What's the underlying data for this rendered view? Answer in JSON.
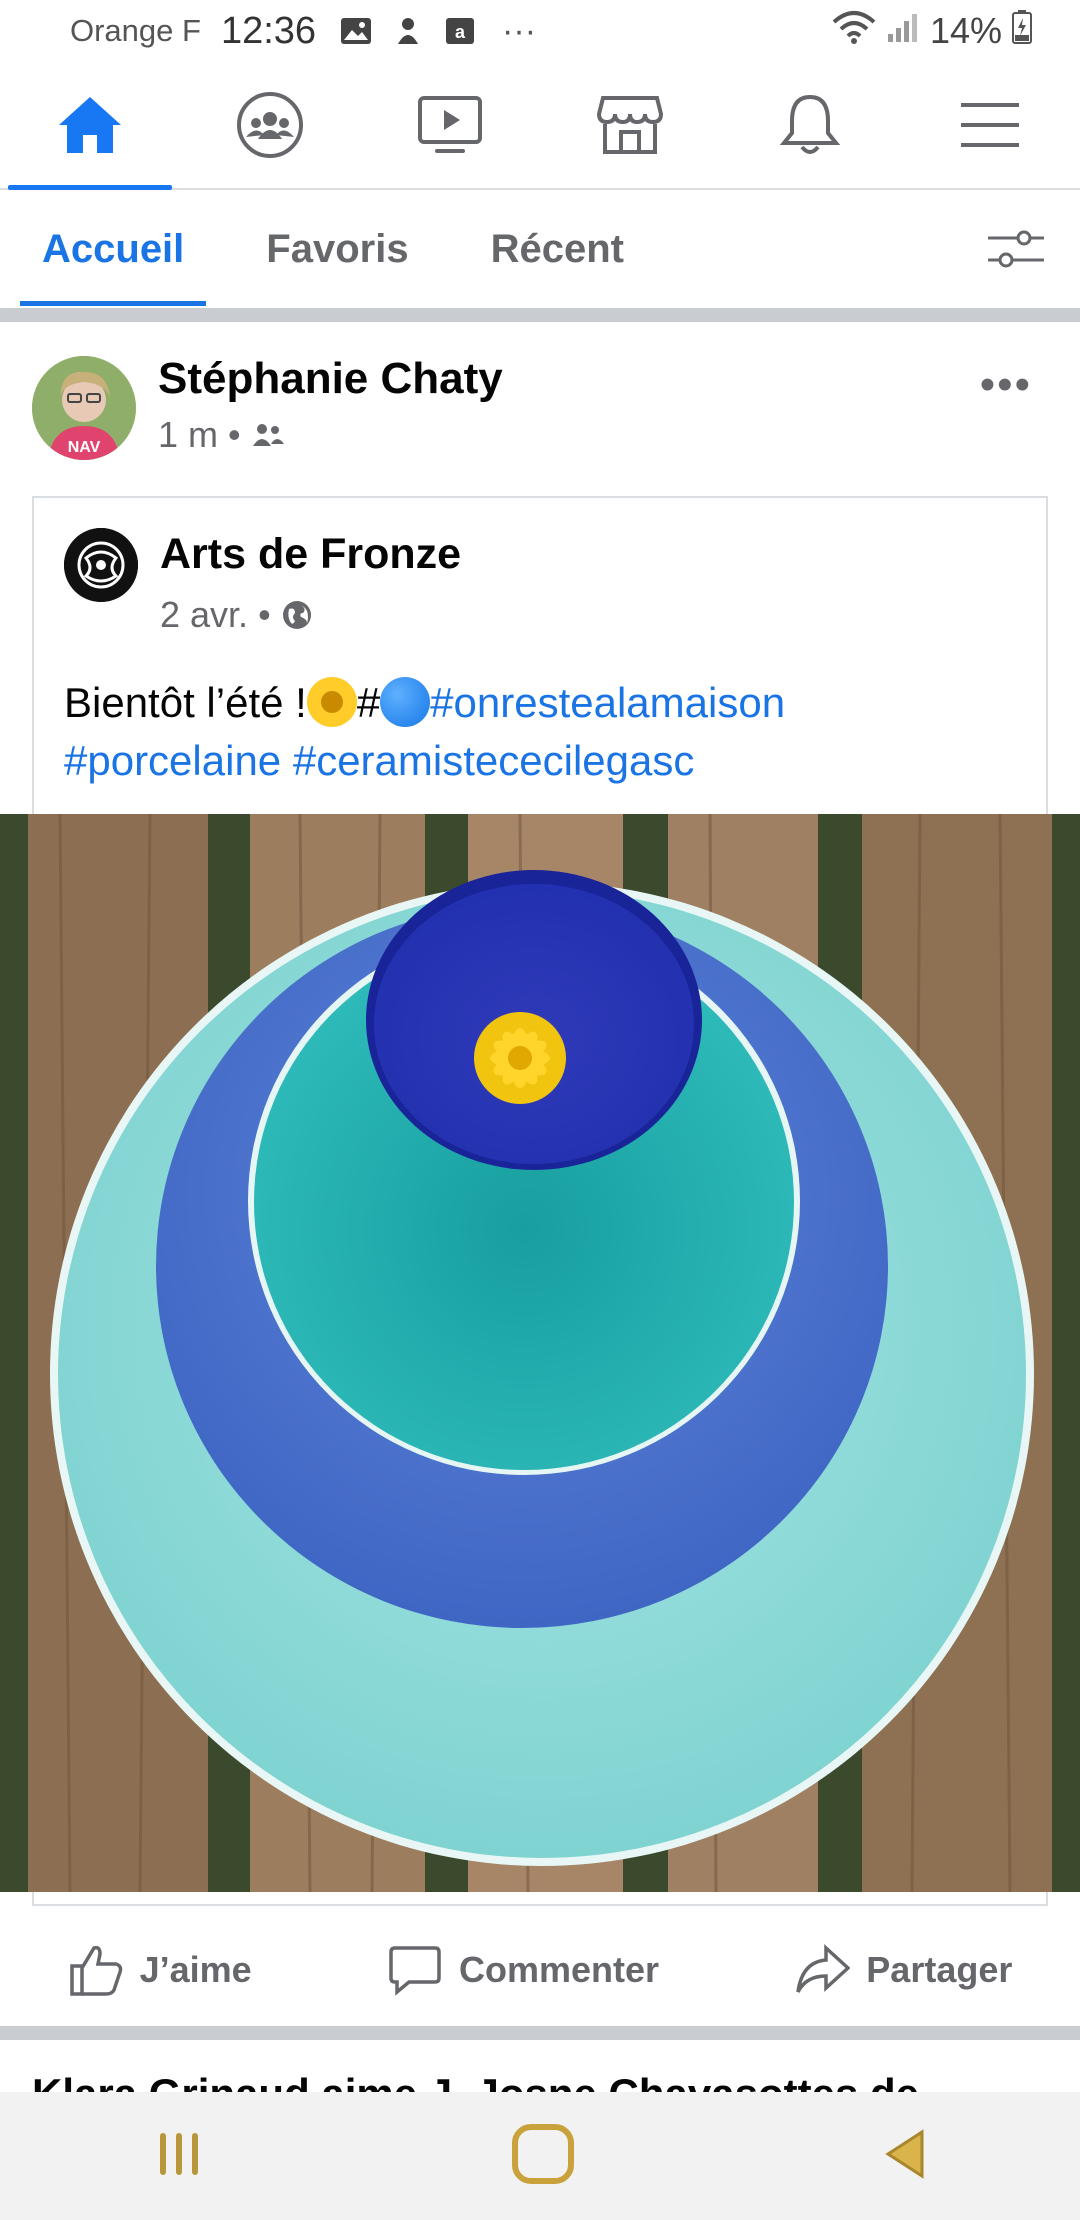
{
  "status_bar": {
    "carrier": "Orange F",
    "time": "12:36",
    "more": "···",
    "battery": "14%"
  },
  "top_nav": {
    "items": [
      {
        "name": "home",
        "icon": "home-icon",
        "active": true
      },
      {
        "name": "groups",
        "icon": "groups-icon",
        "active": false
      },
      {
        "name": "watch",
        "icon": "video-icon",
        "active": false
      },
      {
        "name": "marketplace",
        "icon": "shop-icon",
        "active": false
      },
      {
        "name": "notifications",
        "icon": "bell-icon",
        "active": false
      },
      {
        "name": "menu",
        "icon": "hamburger-icon",
        "active": false
      }
    ],
    "accent": "#1877f2"
  },
  "sub_tabs": [
    {
      "label": "Accueil",
      "active": true
    },
    {
      "label": "Favoris",
      "active": false
    },
    {
      "label": "Récent",
      "active": false
    }
  ],
  "post": {
    "author": "Stéphanie Chaty",
    "time": "1 m",
    "audience_icon": "friends-icon",
    "more": "•••",
    "shared": {
      "page_name": "Arts de Fronze",
      "time": "2 avr.",
      "audience_icon": "globe-icon",
      "text_lead": "Bientôt l’été !",
      "text_hash": "#",
      "tag1": "#onrestealamaison",
      "tag2": "#porcelaine",
      "tag3": "#ceramistececilegasc"
    },
    "actions": {
      "like": "J’aime",
      "comment": "Commenter",
      "share": "Partager"
    }
  },
  "next_post_peek": "Klara Grinaud aime J. Josne Chavasottes de"
}
